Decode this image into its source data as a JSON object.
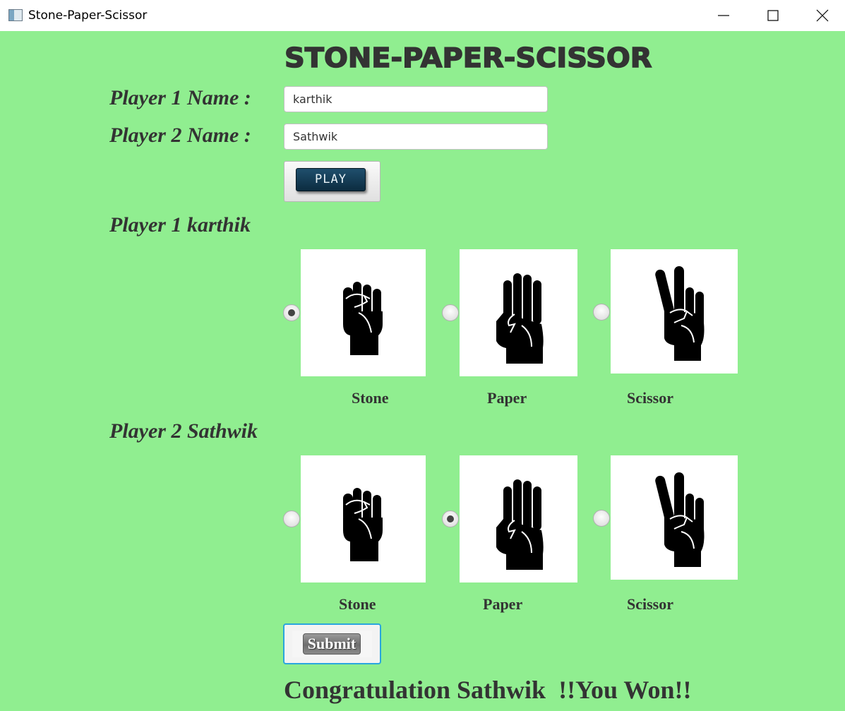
{
  "window": {
    "title": "Stone-Paper-Scissor",
    "icon": "app-icon",
    "controls": [
      "minimize-icon",
      "maximize-icon",
      "close-icon"
    ]
  },
  "app": {
    "title": "STONE-PAPER-SCISSOR"
  },
  "form": {
    "player1_label": "Player 1 Name :",
    "player1_value": "karthik",
    "player2_label": "Player 2 Name :",
    "player2_value": "Sathwik",
    "play_label": "PLAY"
  },
  "player1": {
    "heading": "Player 1 karthik",
    "choices": [
      {
        "label": "Stone",
        "icon": "fist-icon",
        "selected": true
      },
      {
        "label": "Paper",
        "icon": "open-hand-icon",
        "selected": false
      },
      {
        "label": "Scissor",
        "icon": "victory-hand-icon",
        "selected": false
      }
    ]
  },
  "player2": {
    "heading": "Player 2 Sathwik",
    "choices": [
      {
        "label": "Stone",
        "icon": "fist-icon",
        "selected": false
      },
      {
        "label": "Paper",
        "icon": "open-hand-icon",
        "selected": true
      },
      {
        "label": "Scissor",
        "icon": "victory-hand-icon",
        "selected": false
      }
    ]
  },
  "submit_label": "Submit",
  "result_message": "Congratulation Sathwik  !!You Won!!",
  "colors": {
    "background": "#90ee90",
    "text": "#333333",
    "focus_border": "#2aa6dd"
  }
}
